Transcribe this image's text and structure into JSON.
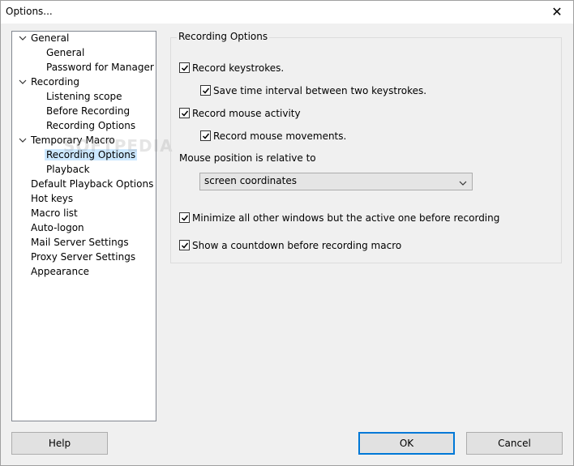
{
  "window": {
    "title": "Options...",
    "close_glyph": "✕"
  },
  "tree": {
    "items": [
      {
        "label": "General",
        "level": 0,
        "expanded": true
      },
      {
        "label": "General",
        "level": 1
      },
      {
        "label": "Password for Manager",
        "level": 1
      },
      {
        "label": "Recording",
        "level": 0,
        "expanded": true
      },
      {
        "label": "Listening scope",
        "level": 1
      },
      {
        "label": "Before Recording",
        "level": 1
      },
      {
        "label": "Recording Options",
        "level": 1
      },
      {
        "label": "Temporary Macro",
        "level": 0,
        "expanded": true
      },
      {
        "label": "Recording Options",
        "level": 1,
        "selected": true
      },
      {
        "label": "Playback",
        "level": 1
      },
      {
        "label": "Default Playback Options",
        "level": 0
      },
      {
        "label": "Hot keys",
        "level": 0
      },
      {
        "label": "Macro list",
        "level": 0
      },
      {
        "label": "Auto-logon",
        "level": 0
      },
      {
        "label": "Mail Server Settings",
        "level": 0
      },
      {
        "label": "Proxy Server Settings",
        "level": 0
      },
      {
        "label": "Appearance",
        "level": 0
      }
    ]
  },
  "watermark": "SOFTPEDIA",
  "panel": {
    "group_title": "Recording Options",
    "record_keystrokes": {
      "label": "Record keystrokes.",
      "checked": true
    },
    "save_time_interval": {
      "label": "Save time interval between two keystrokes.",
      "checked": true
    },
    "record_mouse_activity": {
      "label": "Record mouse activity",
      "checked": true
    },
    "record_mouse_movements": {
      "label": "Record mouse movements.",
      "checked": true
    },
    "mouse_position_label": "Mouse position is relative to",
    "mouse_position_select": {
      "value": "screen coordinates"
    },
    "minimize_windows": {
      "label": "Minimize all other windows but the active one before recording",
      "checked": true
    },
    "show_countdown": {
      "label": "Show a countdown before recording macro",
      "checked": true
    }
  },
  "buttons": {
    "help": "Help",
    "ok": "OK",
    "cancel": "Cancel"
  },
  "colors": {
    "selection": "#cce8ff",
    "default_button_border": "#0078d7"
  }
}
